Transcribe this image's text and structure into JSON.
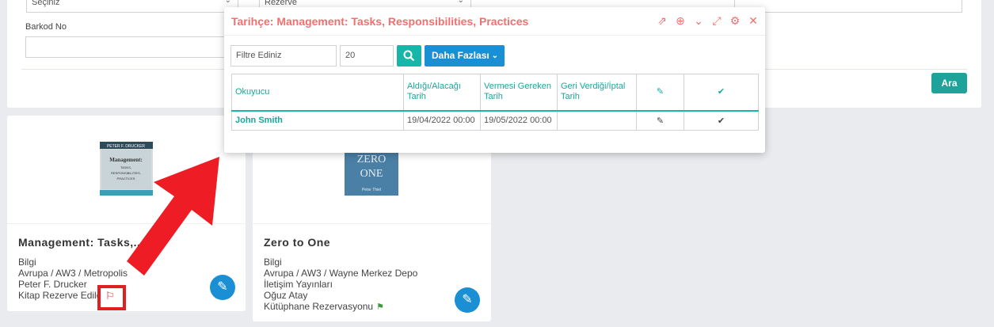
{
  "search": {
    "select1_value": "Seçiniz",
    "select2_value": "Rezerve",
    "barcode_label": "Barkod No",
    "barcode_value": "",
    "search_button": "Ara"
  },
  "cards": [
    {
      "title": "Management: Tasks,...",
      "cover_alt": "Management: Tasks, Responsibilities, Practices",
      "cover_text": "Management:\nTASKS,\nRESPONSIBILITIES,\nPRACTICES",
      "cover_author": "PETER F. DRUCKER",
      "lines": [
        "Bilgi",
        "Avrupa / AW3 / Metropolis",
        "Peter F. Drucker",
        "Kitap Rezerve Edild"
      ]
    },
    {
      "title": "Zero to One",
      "cover_text_1": "ZERO",
      "cover_text_2": "ONE",
      "cover_author": "Peter Thiel",
      "lines": [
        "Bilgi",
        "Avrupa / AW3 / Wayne Merkez Depo",
        "İletişim Yayınları",
        "Oğuz Atay",
        "Kütüphane Rezervasyonu"
      ]
    }
  ],
  "modal": {
    "title": "Tarihçe: Management: Tasks, Responsibilities, Practices",
    "filter_placeholder": "Filtre Ediniz",
    "page_size": "20",
    "more_button": "Daha Fazlası",
    "columns": [
      "Okuyucu",
      "Aldığı/Alacağı Tarih",
      "Vermesi Gereken Tarih",
      "Geri Verdiği/İptal Tarih"
    ],
    "rows": [
      {
        "reader": "John Smith",
        "taken": "19/04/2022 00:00",
        "due": "19/05/2022 00:00",
        "returned": ""
      }
    ],
    "tool_icons": [
      "export-icon",
      "plus-circle-icon",
      "chevron-down-icon",
      "expand-icon",
      "gear-icon",
      "close-icon"
    ]
  },
  "colors": {
    "accent_teal": "#18b6a8",
    "primary_blue": "#1a8fd4",
    "modal_title": "#f07070",
    "annotation_red": "#e02020"
  }
}
